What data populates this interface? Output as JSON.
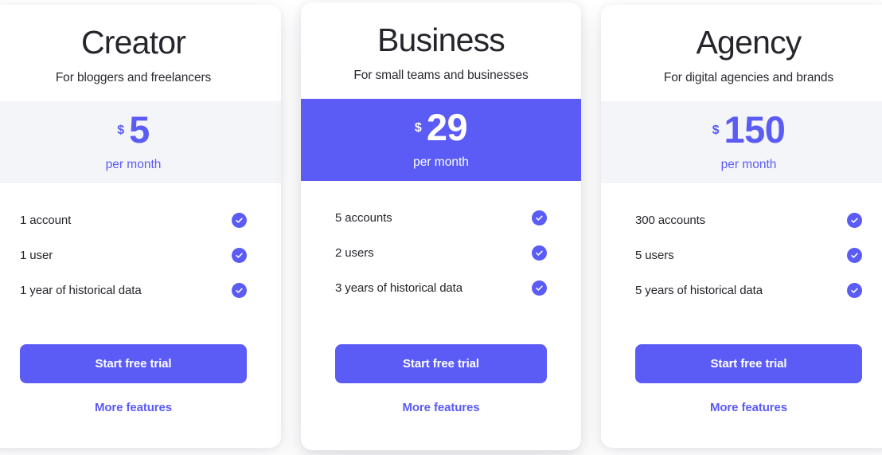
{
  "theme": {
    "accent": "#5B5BF6",
    "band_muted": "#F4F5F9",
    "text_dark": "#25262B",
    "page_background": "#FFFFFF"
  },
  "plans": [
    {
      "id": "creator",
      "name": "Creator",
      "tagline": "For bloggers and freelancers",
      "featured": false,
      "price": {
        "currency": "$",
        "amount": "5",
        "period": "per month"
      },
      "features": [
        {
          "label": "1 account",
          "icon": "check-circle-icon",
          "included": true
        },
        {
          "label": "1 user",
          "icon": "check-circle-icon",
          "included": true
        },
        {
          "label": "1 year of historical data",
          "icon": "check-circle-icon",
          "included": true
        }
      ],
      "cta_label": "Start free trial",
      "more_label": "More features"
    },
    {
      "id": "business",
      "name": "Business",
      "tagline": "For small teams and businesses",
      "featured": true,
      "price": {
        "currency": "$",
        "amount": "29",
        "period": "per month"
      },
      "features": [
        {
          "label": "5 accounts",
          "icon": "check-circle-icon",
          "included": true
        },
        {
          "label": "2 users",
          "icon": "check-circle-icon",
          "included": true
        },
        {
          "label": "3 years of historical data",
          "icon": "check-circle-icon",
          "included": true
        }
      ],
      "cta_label": "Start free trial",
      "more_label": "More features"
    },
    {
      "id": "agency",
      "name": "Agency",
      "tagline": "For digital agencies and brands",
      "featured": false,
      "price": {
        "currency": "$",
        "amount": "150",
        "period": "per month"
      },
      "features": [
        {
          "label": "300 accounts",
          "icon": "check-circle-icon",
          "included": true
        },
        {
          "label": "5 users",
          "icon": "check-circle-icon",
          "included": true
        },
        {
          "label": "5 years of historical data",
          "icon": "check-circle-icon",
          "included": true
        }
      ],
      "cta_label": "Start free trial",
      "more_label": "More features"
    }
  ]
}
